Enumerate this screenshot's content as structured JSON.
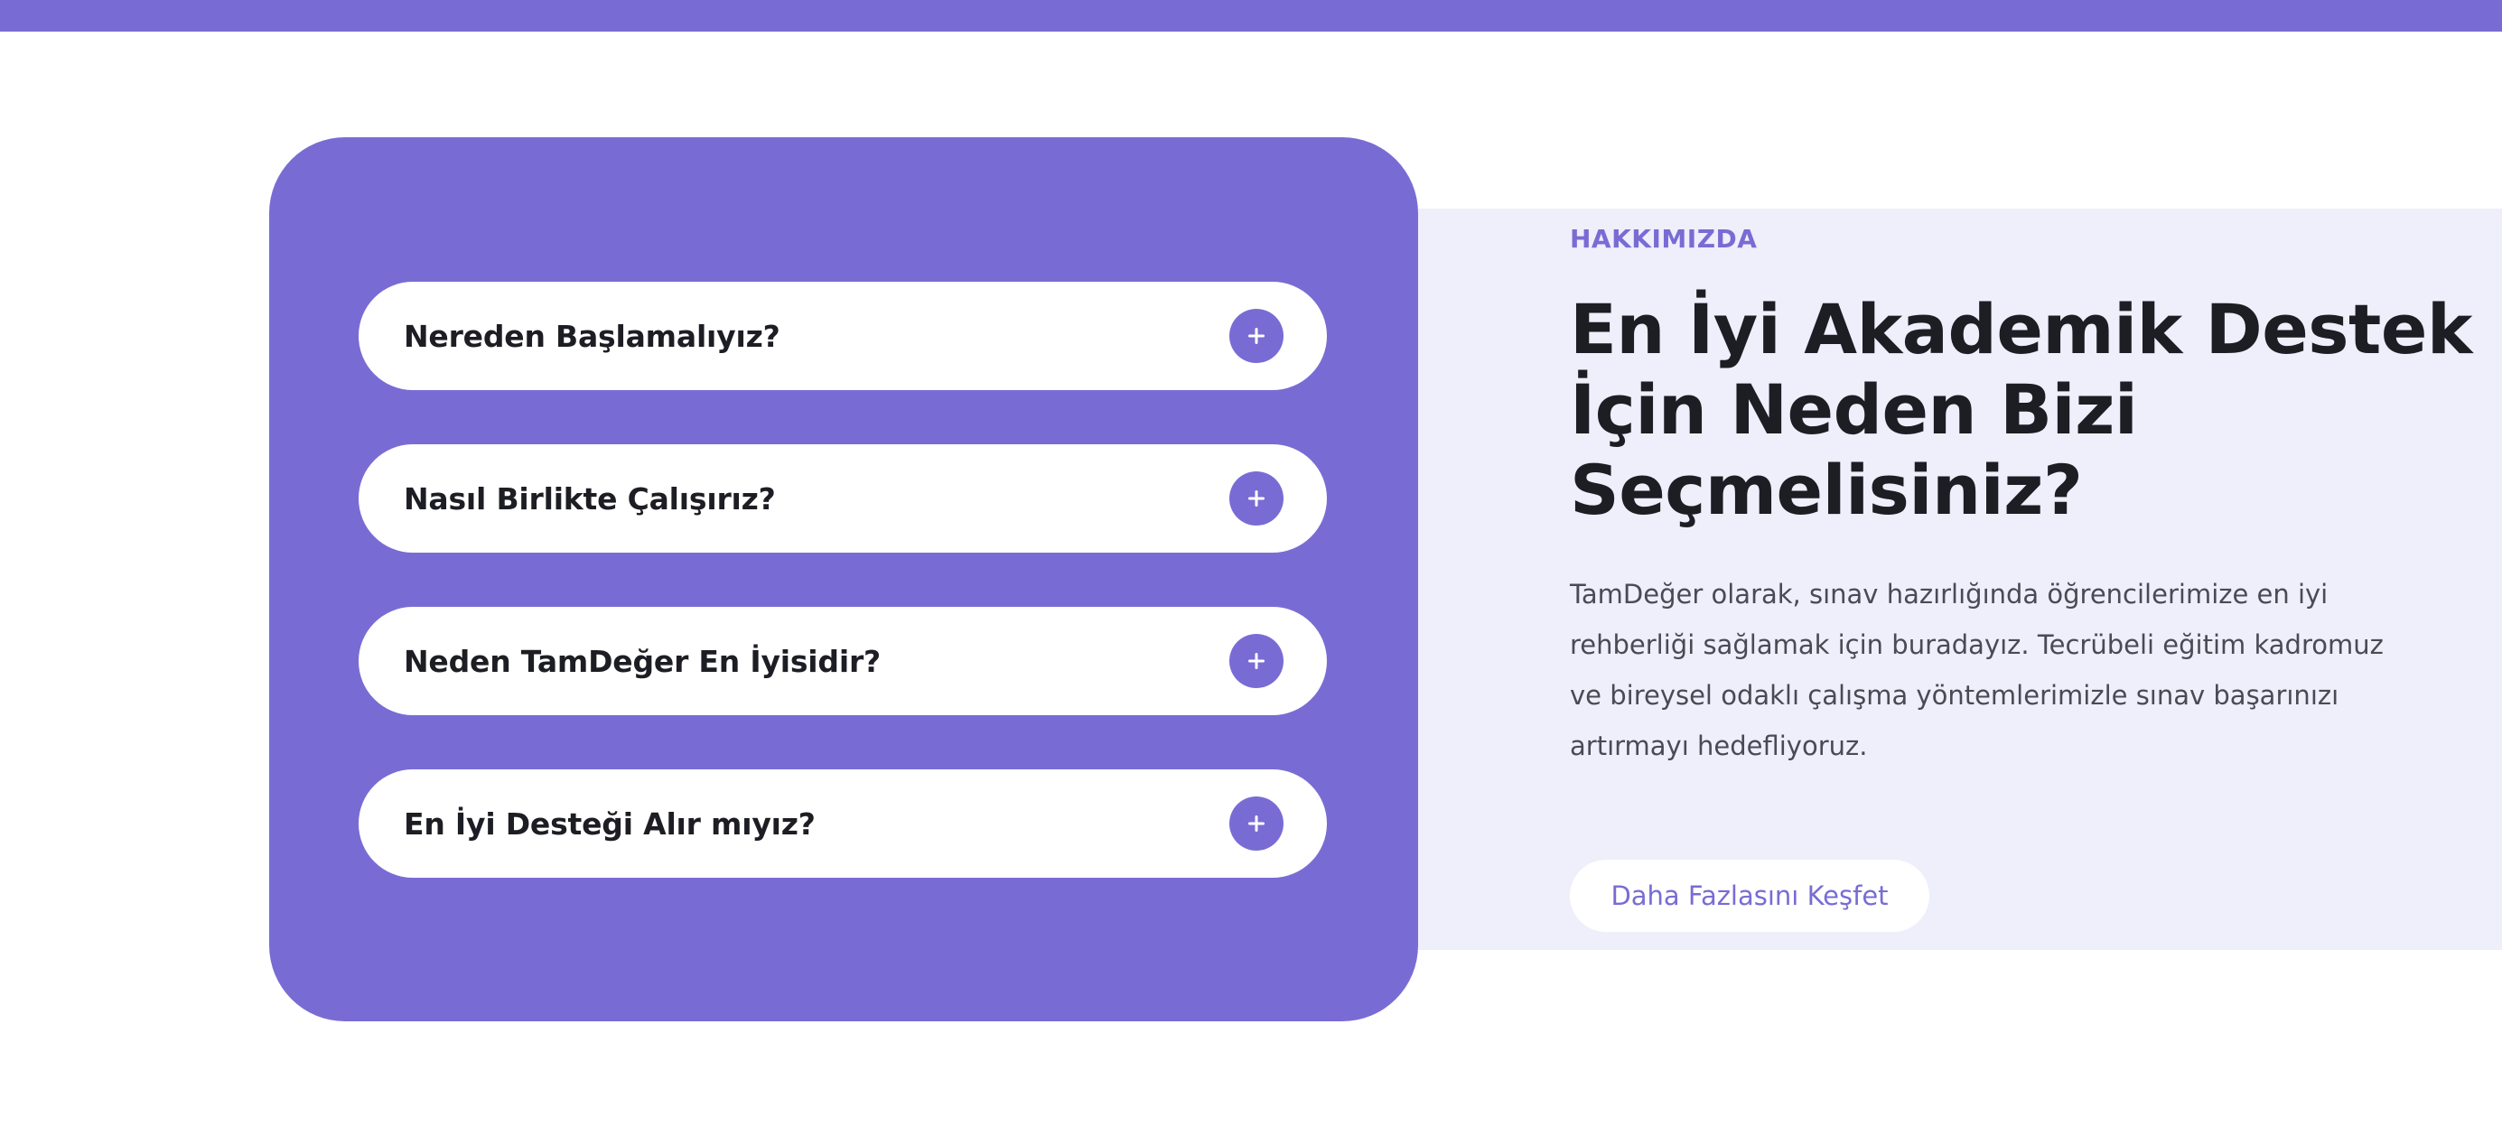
{
  "colors": {
    "accent": "#786cd4",
    "panel_bg": "#efeefb",
    "heading": "#1d1d24",
    "body": "#4a4a55",
    "white": "#ffffff"
  },
  "faq": {
    "items": [
      {
        "question": "Nereden Başlamalıyız?",
        "icon": "plus-icon"
      },
      {
        "question": "Nasıl Birlikte Çalışırız?",
        "icon": "plus-icon"
      },
      {
        "question": "Neden TamDeğer En İyisidir?",
        "icon": "plus-icon"
      },
      {
        "question": "En İyi Desteği Alır mıyız?",
        "icon": "plus-icon"
      }
    ]
  },
  "about": {
    "eyebrow": "HAKKIMIZDA",
    "headline": "En İyi Akademik Destek İçin Neden Bizi Seçmelisiniz?",
    "body": "TamDeğer olarak, sınav hazırlığında öğrencilerimize en iyi rehberliği sağlamak için buradayız. Tecrübeli eğitim kadromuz ve bireysel odaklı çalışma yöntemlerimizle sınav başarınızı artırmayı hedefliyoruz.",
    "cta_label": "Daha Fazlasını Keşfet"
  }
}
